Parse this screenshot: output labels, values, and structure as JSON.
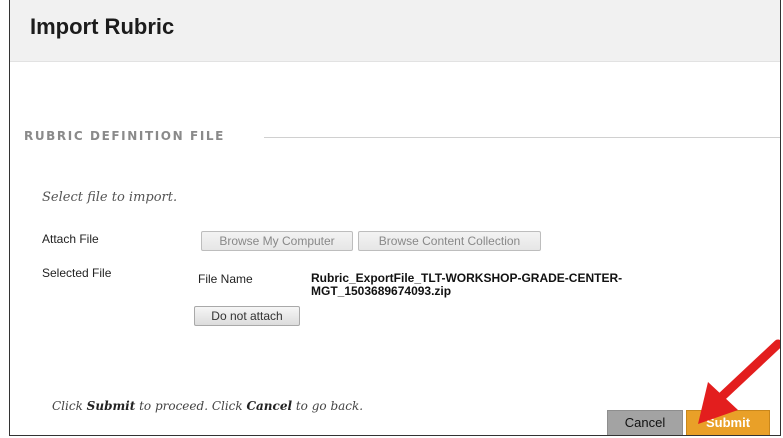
{
  "page": {
    "title": "Import Rubric"
  },
  "section": {
    "legend": "RUBRIC DEFINITION FILE"
  },
  "instructions": "Select file to import.",
  "attach": {
    "label": "Attach File",
    "browse_computer": "Browse My Computer",
    "browse_collection": "Browse Content Collection"
  },
  "selected": {
    "label": "Selected File",
    "file_name_label": "File Name",
    "file_name": "Rubric_ExportFile_TLT-WORKSHOP-GRADE-CENTER-MGT_1503689674093.zip",
    "do_not_attach": "Do not attach"
  },
  "footer": {
    "text_1": "Click ",
    "submit_word": "Submit",
    "text_2": " to proceed. Click ",
    "cancel_word": "Cancel",
    "text_3": " to go back.",
    "cancel_label": "Cancel",
    "submit_label": "Submit"
  },
  "colors": {
    "submit_bg": "#e9a028",
    "cancel_bg": "#a3a3a3",
    "arrow": "#e31e1e"
  },
  "icons": {
    "annotation": "red-arrow-icon"
  }
}
